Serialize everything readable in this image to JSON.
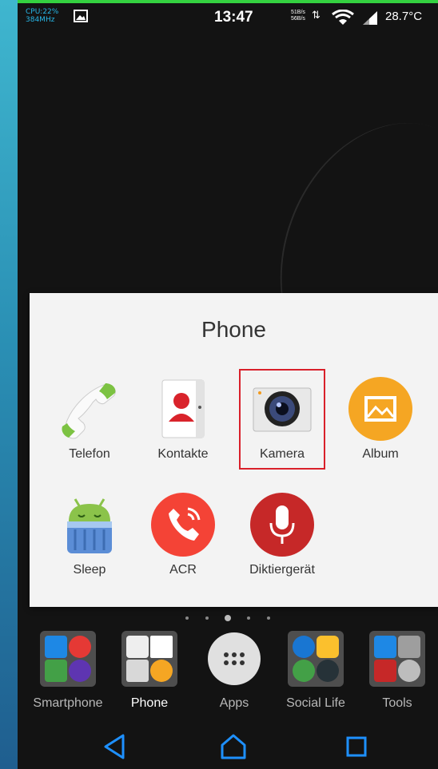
{
  "status": {
    "cpu_line1": "CPU:22%",
    "cpu_line2": "384MHz",
    "time": "13:47",
    "net_up": "51B/s",
    "net_down": "56B/s",
    "temperature": "28.7°C"
  },
  "folder": {
    "title": "Phone",
    "apps": [
      {
        "label": "Telefon",
        "icon": "phone-handset-icon"
      },
      {
        "label": "Kontakte",
        "icon": "contacts-icon"
      },
      {
        "label": "Kamera",
        "icon": "camera-icon"
      },
      {
        "label": "Album",
        "icon": "album-icon"
      },
      {
        "label": "Sleep",
        "icon": "android-sleep-icon"
      },
      {
        "label": "ACR",
        "icon": "call-recorder-icon"
      },
      {
        "label": "Diktiergerät",
        "icon": "microphone-icon"
      }
    ],
    "highlighted": "Kamera"
  },
  "pager": {
    "pages": 5,
    "active": 2
  },
  "dock": [
    {
      "label": "Smartphone",
      "icon": "smartphone-folder-icon"
    },
    {
      "label": "Phone",
      "icon": "phone-folder-icon",
      "active": true
    },
    {
      "label": "Apps",
      "icon": "apps-drawer-icon"
    },
    {
      "label": "Social Life",
      "icon": "social-folder-icon"
    },
    {
      "label": "Tools",
      "icon": "tools-folder-icon"
    }
  ],
  "colors": {
    "accent": "#1e90ff",
    "highlight": "#d9202a",
    "status_green": "#34d140"
  }
}
